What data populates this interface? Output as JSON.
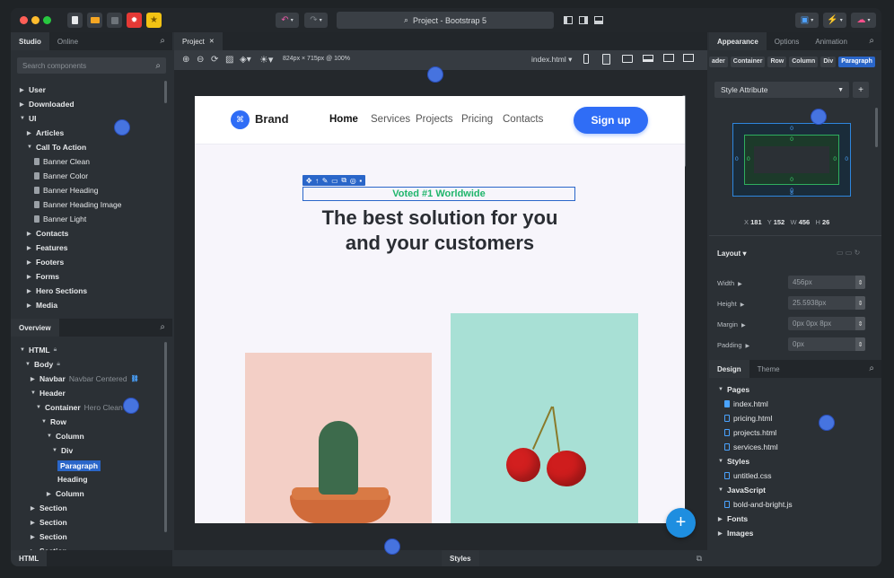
{
  "titlebar": {
    "search_text": "Project - Bootstrap 5",
    "undo_icon": "undo-icon",
    "redo_icon": "redo-icon"
  },
  "left": {
    "tabs": [
      "Studio",
      "Online"
    ],
    "search_placeholder": "Search components",
    "tree": [
      {
        "label": "User",
        "level": 0,
        "bold": true,
        "arrow": "right"
      },
      {
        "label": "Downloaded",
        "level": 0,
        "bold": true,
        "arrow": "right"
      },
      {
        "label": "UI",
        "level": 0,
        "bold": true,
        "arrow": "down"
      },
      {
        "label": "Articles",
        "level": 1,
        "bold": true,
        "arrow": "right"
      },
      {
        "label": "Call To Action",
        "level": 1,
        "bold": true,
        "arrow": "down"
      },
      {
        "label": "Banner Clean",
        "level": 2,
        "file": true
      },
      {
        "label": "Banner Color",
        "level": 2,
        "file": true
      },
      {
        "label": "Banner Heading",
        "level": 2,
        "file": true
      },
      {
        "label": "Banner Heading Image",
        "level": 2,
        "file": true
      },
      {
        "label": "Banner Light",
        "level": 2,
        "file": true
      },
      {
        "label": "Contacts",
        "level": 1,
        "bold": true,
        "arrow": "right"
      },
      {
        "label": "Features",
        "level": 1,
        "bold": true,
        "arrow": "right"
      },
      {
        "label": "Footers",
        "level": 1,
        "bold": true,
        "arrow": "right"
      },
      {
        "label": "Forms",
        "level": 1,
        "bold": true,
        "arrow": "right"
      },
      {
        "label": "Hero Sections",
        "level": 1,
        "bold": true,
        "arrow": "right"
      },
      {
        "label": "Media",
        "level": 1,
        "bold": true,
        "arrow": "right"
      }
    ],
    "overview_tab": "Overview",
    "overview": [
      {
        "label": "HTML",
        "level": 0,
        "arrow": "down",
        "lock": true
      },
      {
        "label": "Body",
        "level": 1,
        "arrow": "down",
        "lock": true
      },
      {
        "label": "Navbar",
        "extra": "Navbar Centered",
        "level": 2,
        "arrow": "right",
        "link": true
      },
      {
        "label": "Header",
        "level": 2,
        "arrow": "down"
      },
      {
        "label": "Container",
        "extra": "Hero Clean",
        "level": 3,
        "arrow": "down"
      },
      {
        "label": "Row",
        "level": 4,
        "arrow": "down"
      },
      {
        "label": "Column",
        "level": 5,
        "arrow": "down"
      },
      {
        "label": "Div",
        "level": 6,
        "arrow": "down"
      },
      {
        "label": "Paragraph",
        "level": 7,
        "selected": true
      },
      {
        "label": "Heading",
        "level": 7
      },
      {
        "label": "Column",
        "level": 5,
        "arrow": "right"
      },
      {
        "label": "Section",
        "level": 2,
        "arrow": "right"
      },
      {
        "label": "Section",
        "level": 2,
        "arrow": "right"
      },
      {
        "label": "Section",
        "level": 2,
        "arrow": "right"
      },
      {
        "label": "Section",
        "level": 2,
        "arrow": "right"
      }
    ],
    "bottom_tab": "HTML"
  },
  "center": {
    "tab": "Project",
    "size_info": "824px × 715px @ 100%",
    "file": "index.html",
    "bottom_tab": "Styles",
    "page": {
      "brand": "Brand",
      "nav_links": [
        "Home",
        "Services",
        "Projects",
        "Pricing",
        "Contacts"
      ],
      "signup": "Sign up",
      "badge": "Voted #1 Worldwide",
      "heading_line1": "The best solution for you",
      "heading_line2": "and your customers",
      "fab": "+"
    }
  },
  "right": {
    "tabs": [
      "Appearance",
      "Options",
      "Animation"
    ],
    "breadcrumb": [
      "ader",
      "Container",
      "Row",
      "Column",
      "Div",
      "Paragraph"
    ],
    "style_attribute": "Style Attribute",
    "box": {
      "margin": "0",
      "border": "0",
      "padding": "0",
      "pad_bottom": "8"
    },
    "coords": {
      "x_label": "X",
      "x": "181",
      "y_label": "Y",
      "y": "152",
      "w_label": "W",
      "w": "456",
      "h_label": "H",
      "h": "26"
    },
    "layout_label": "Layout",
    "props": [
      {
        "label": "Width",
        "value": "456px"
      },
      {
        "label": "Height",
        "value": "25.5938px"
      },
      {
        "label": "Margin",
        "value": "0px 0px 8px"
      },
      {
        "label": "Padding",
        "value": "0px"
      }
    ],
    "design_tabs": [
      "Design",
      "Theme"
    ],
    "design_tree": [
      {
        "label": "Pages",
        "level": 0,
        "arrow": "down",
        "bold": true
      },
      {
        "label": "index.html",
        "level": 1,
        "file": "blue"
      },
      {
        "label": "pricing.html",
        "level": 1,
        "file": "outline"
      },
      {
        "label": "projects.html",
        "level": 1,
        "file": "outline"
      },
      {
        "label": "services.html",
        "level": 1,
        "file": "outline"
      },
      {
        "label": "Styles",
        "level": 0,
        "arrow": "down",
        "bold": true
      },
      {
        "label": "untitled.css",
        "level": 1,
        "file": "outline"
      },
      {
        "label": "JavaScript",
        "level": 0,
        "arrow": "down",
        "bold": true
      },
      {
        "label": "bold-and-bright.js",
        "level": 1,
        "file": "outline"
      },
      {
        "label": "Fonts",
        "level": 0,
        "arrow": "right",
        "bold": true
      },
      {
        "label": "Images",
        "level": 0,
        "arrow": "right",
        "bold": true
      }
    ]
  },
  "colors": {
    "accent": "#2f6df6",
    "green": "#1fb56b",
    "selection": "#2a66c9"
  }
}
